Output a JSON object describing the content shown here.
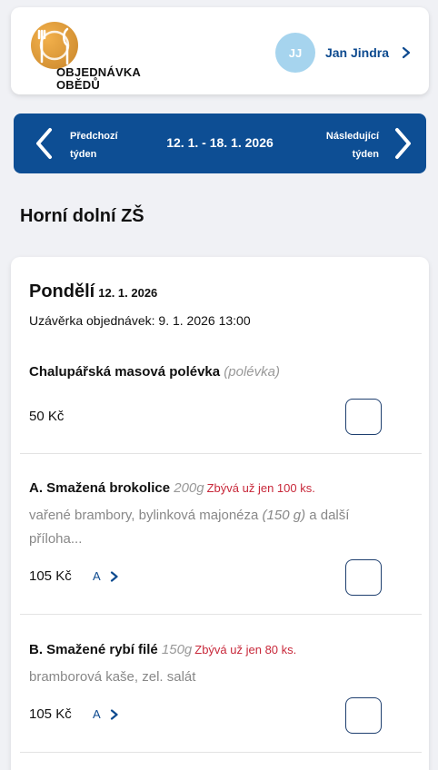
{
  "header": {
    "logo_text_line1": "OBJEDNÁVKA",
    "logo_text_line2": "OBĚDŮ",
    "user_initials": "JJ",
    "user_name": "Jan Jindra"
  },
  "week_nav": {
    "prev_line1": "Předchozí",
    "prev_line2": "týden",
    "range": "12. 1. - 18. 1. 2026",
    "next_line1": "Následující",
    "next_line2": "týden"
  },
  "school": "Horní dolní ZŠ",
  "day": {
    "name": "Pondělí",
    "date": "12. 1. 2026",
    "deadline": "Uzávěrka objednávek: 9. 1. 2026 13:00"
  },
  "items": [
    {
      "name": "Chalupářská masová polévka",
      "sub": "(polévka)",
      "price": "50 Kč"
    },
    {
      "name": "A. Smažená brokolice",
      "sub": "200g",
      "warn": "Zbývá už jen 100 ks.",
      "desc_a": "vařené brambory, bylinková majonéza ",
      "desc_b": "(150 g)",
      "desc_c": " a další příloha...",
      "price": "105 Kč",
      "allergen": "A"
    },
    {
      "name": "B. Smažené rybí filé",
      "sub": "150g",
      "warn": "Zbývá už jen 80 ks.",
      "desc_a": "bramborová kaše, zel. salát",
      "price": "105 Kč",
      "allergen": "A"
    }
  ],
  "colors": {
    "primary": "#0d4e94",
    "avatar": "#a6d4ee",
    "warning": "#c8283a",
    "background": "#f0f1f5"
  }
}
